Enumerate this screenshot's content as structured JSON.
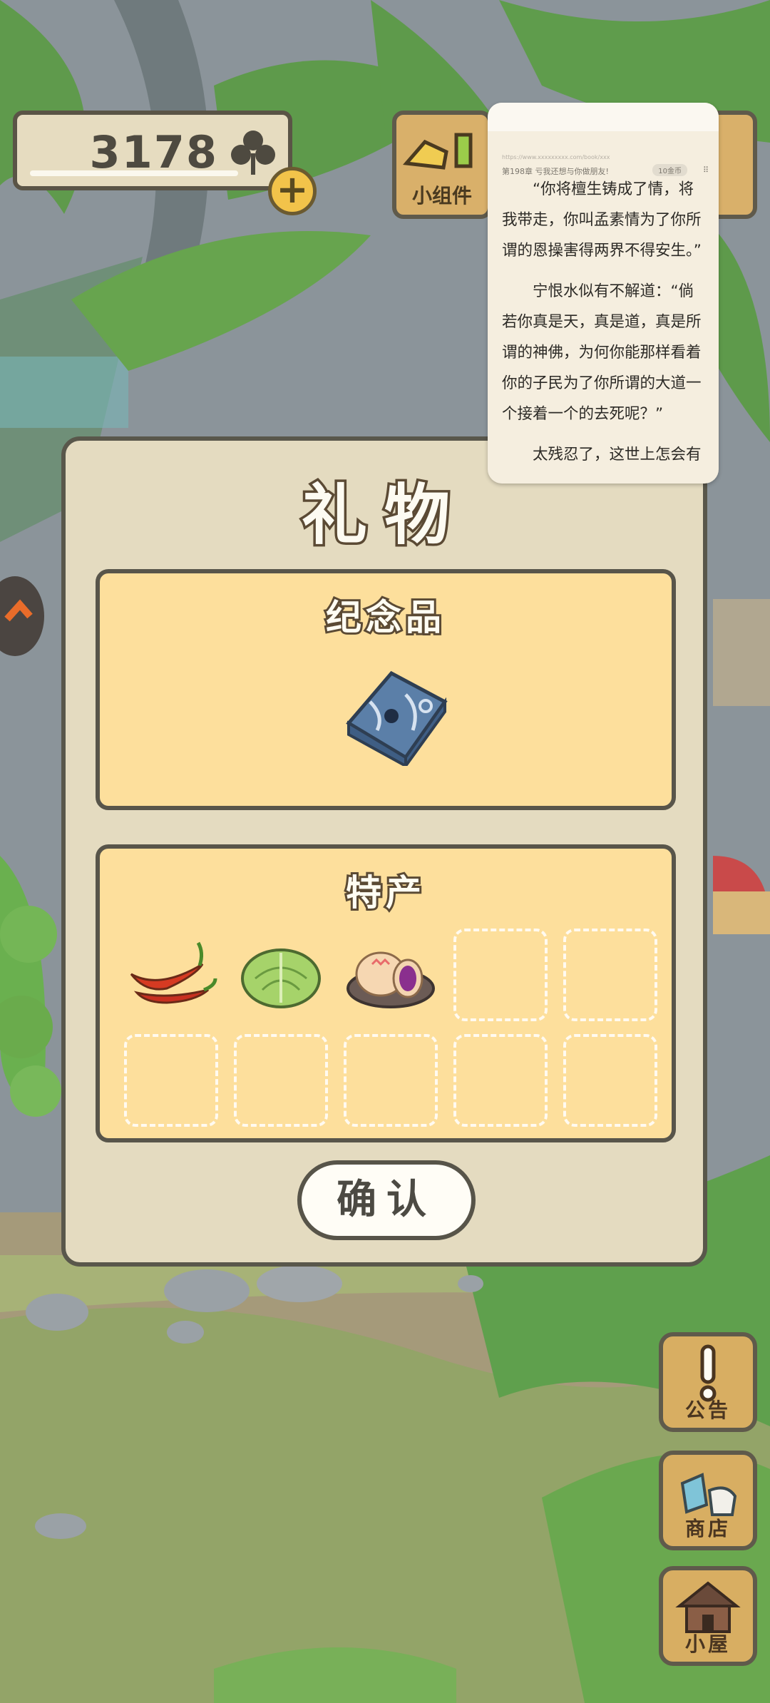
{
  "hud": {
    "clover_count": "3178",
    "widget_label": "小组件"
  },
  "reader": {
    "url": "https://www.xxxxxxxxx.com/book/xxx",
    "chapter": "第198章 亏我还想与你做朋友!",
    "pill": "10金币",
    "dots": "⠿",
    "paragraphs": [
      "“你将檀生铸成了情，将我带走，你叫孟素情为了你所谓的恩操害得两界不得安生。”",
      "宁恨水似有不解道：“倘若你真是天，真是道，真是所谓的神佛，为何你能那样看着你的子民为了你所谓的大道一个接着一个的去死呢？”",
      "太残忍了，这世上怎会有"
    ]
  },
  "dialog": {
    "title": "礼物",
    "souvenir_title": "纪念品",
    "souvenir_item": "folded-blue-cloth",
    "specialty_title": "特产",
    "specialty_items": [
      "red-chili-peppers",
      "green-cabbage",
      "purple-yam-mooncake"
    ],
    "empty_slots": 7,
    "confirm_label": "确认"
  },
  "side_buttons": {
    "notice_label": "公告",
    "shop_label": "商店",
    "house_label": "小屋"
  },
  "colors": {
    "panel": "#fddf9c",
    "dialog_bg": "#e4dbc0",
    "border": "#59574b",
    "button_wood": "#d8ae62"
  }
}
